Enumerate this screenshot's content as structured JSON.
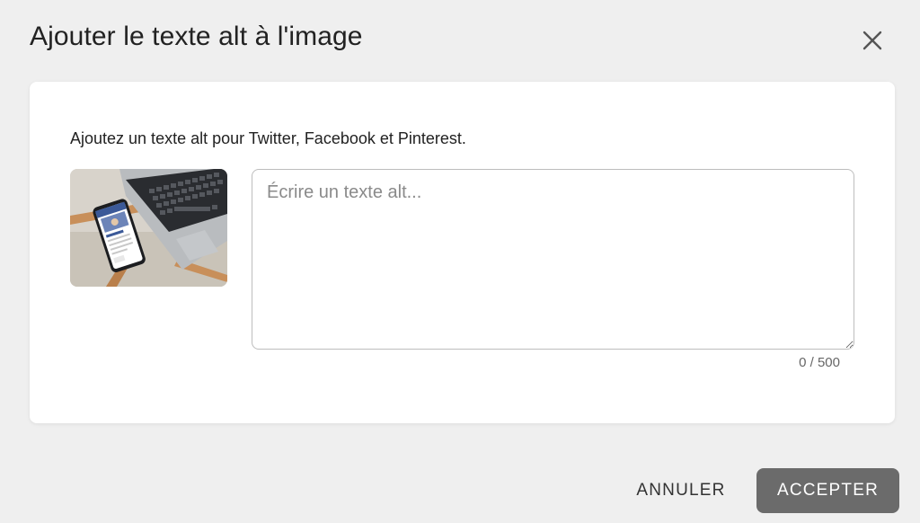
{
  "dialog": {
    "title": "Ajouter le texte alt à l'image",
    "close_icon": "close-icon"
  },
  "card": {
    "subtitle": "Ajoutez un texte alt pour Twitter, Facebook et Pinterest.",
    "image": {
      "description_icon": "image-thumbnail"
    },
    "alt_input": {
      "placeholder": "Écrire un texte alt...",
      "value": ""
    },
    "counter": "0 / 500"
  },
  "footer": {
    "cancel_label": "ANNULER",
    "accept_label": "ACCEPTER"
  },
  "colors": {
    "background": "#efefef",
    "card": "#ffffff",
    "accept_button": "#6b6b6b"
  }
}
